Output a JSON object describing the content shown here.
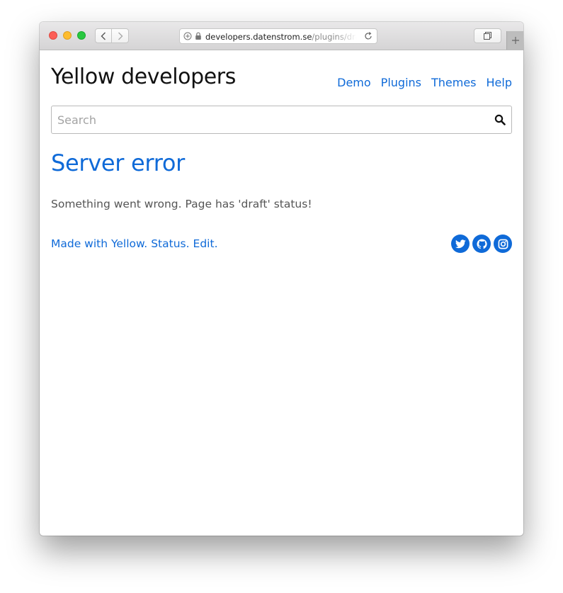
{
  "browser": {
    "url_host": "developers.datenstrom.se",
    "url_path": "/plugins/dra"
  },
  "site": {
    "title": "Yellow developers",
    "nav": [
      "Demo",
      "Plugins",
      "Themes",
      "Help"
    ]
  },
  "search": {
    "placeholder": "Search",
    "value": ""
  },
  "main": {
    "title": "Server error",
    "message": "Something went wrong. Page has 'draft' status!"
  },
  "footer": {
    "links": [
      "Made with Yellow.",
      "Status.",
      "Edit."
    ],
    "social_icons": [
      "twitter-icon",
      "github-icon",
      "instagram-icon"
    ]
  },
  "colors": {
    "link": "#0f6ad8",
    "title": "#111111",
    "text": "#555555"
  }
}
